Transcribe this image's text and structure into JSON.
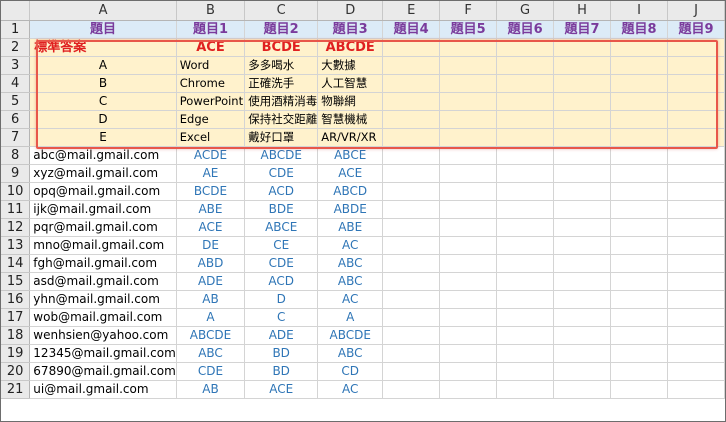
{
  "columns": [
    "A",
    "B",
    "C",
    "D",
    "E",
    "F",
    "G",
    "H",
    "I",
    "J"
  ],
  "title_row": {
    "number": "1",
    "cells": [
      "題目",
      "題目1",
      "題目2",
      "題目3",
      "題目4",
      "題目5",
      "題目6",
      "題目7",
      "題目8",
      "題目9"
    ]
  },
  "answer_row": {
    "number": "2",
    "label": "標準答案",
    "answers": [
      "ACE",
      "BCDE",
      "ABCDE"
    ]
  },
  "options": [
    {
      "number": "3",
      "letter": "A",
      "q1": "Word",
      "q2": "多多喝水",
      "q3": "大數據"
    },
    {
      "number": "4",
      "letter": "B",
      "q1": "Chrome",
      "q2": "正確洗手",
      "q3": "人工智慧"
    },
    {
      "number": "5",
      "letter": "C",
      "q1": "PowerPoint",
      "q2": "使用酒精消毒",
      "q3": "物聯網"
    },
    {
      "number": "6",
      "letter": "D",
      "q1": "Edge",
      "q2": "保持社交距離",
      "q3": "智慧機械"
    },
    {
      "number": "7",
      "letter": "E",
      "q1": "Excel",
      "q2": "戴好口罩",
      "q3": "AR/VR/XR"
    }
  ],
  "responses": [
    {
      "number": "8",
      "email": "abc@mail.gmail.com",
      "a1": "ACDE",
      "a2": "ABCDE",
      "a3": "ABCE"
    },
    {
      "number": "9",
      "email": "xyz@mail.gmail.com",
      "a1": "AE",
      "a2": "CDE",
      "a3": "ACE"
    },
    {
      "number": "10",
      "email": "opq@mail.gmail.com",
      "a1": "BCDE",
      "a2": "ACD",
      "a3": "ABCD"
    },
    {
      "number": "11",
      "email": "ijk@mail.gmail.com",
      "a1": "ABE",
      "a2": "BDE",
      "a3": "ABDE"
    },
    {
      "number": "12",
      "email": "pqr@mail.gmail.com",
      "a1": "ACE",
      "a2": "ABCE",
      "a3": "ABE"
    },
    {
      "number": "13",
      "email": "mno@mail.gmail.com",
      "a1": "DE",
      "a2": "CE",
      "a3": "AC"
    },
    {
      "number": "14",
      "email": "fgh@mail.gmail.com",
      "a1": "ABD",
      "a2": "CDE",
      "a3": "ABC"
    },
    {
      "number": "15",
      "email": "asd@mail.gmail.com",
      "a1": "ADE",
      "a2": "ACD",
      "a3": "ABC"
    },
    {
      "number": "16",
      "email": "yhn@mail.gmail.com",
      "a1": "AB",
      "a2": "D",
      "a3": "AC"
    },
    {
      "number": "17",
      "email": "wob@mail.gmail.com",
      "a1": "A",
      "a2": "C",
      "a3": "A"
    },
    {
      "number": "18",
      "email": "wenhsien@yahoo.com",
      "a1": "ABCDE",
      "a2": "ADE",
      "a3": "ABCDE"
    },
    {
      "number": "19",
      "email": "12345@mail.gmail.com",
      "a1": "ABC",
      "a2": "BD",
      "a3": "ABC"
    },
    {
      "number": "20",
      "email": "67890@mail.gmail.com",
      "a1": "CDE",
      "a2": "BD",
      "a3": "CD"
    },
    {
      "number": "21",
      "email": "ui@mail.gmail.com",
      "a1": "AB",
      "a2": "ACE",
      "a3": "AC"
    }
  ]
}
